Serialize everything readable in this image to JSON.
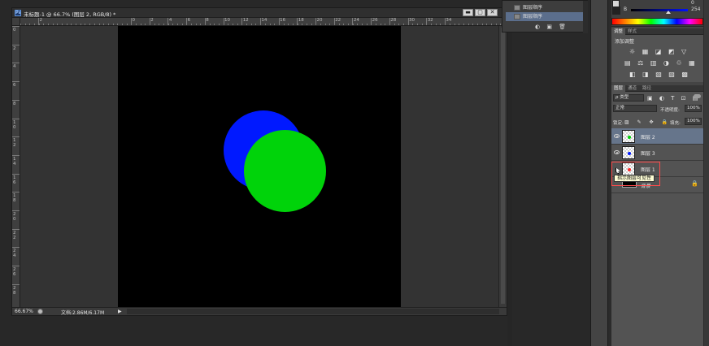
{
  "document": {
    "app_icon": "Ps",
    "title": "未标题-1 @ 66.7% (图层 2, RGB/8) *",
    "win_min": "▬",
    "win_max": "▢",
    "win_close": "✕",
    "ruler_h_labels": [
      "2",
      "0",
      "2",
      "4",
      "6",
      "8",
      "10",
      "12",
      "14",
      "16",
      "18",
      "20",
      "22",
      "24",
      "26",
      "28",
      "30",
      "32",
      "34"
    ],
    "ruler_v_labels": [
      "0",
      "2",
      "4",
      "6",
      "8",
      "1 0",
      "1 2",
      "1 4",
      "1 6",
      "1 8",
      "2 0",
      "2 2",
      "2 4",
      "2 6",
      "2 8"
    ],
    "zoom": "66.67%",
    "doc_size": "文档:2.86M/6.17M",
    "status_arrow": "▶",
    "canvas_color": "#000000",
    "shapes": [
      {
        "name": "blue-circle",
        "color": "#0019ff"
      },
      {
        "name": "green-circle",
        "color": "#00d30a"
      }
    ]
  },
  "history": {
    "items": [
      {
        "label": "图层顺序",
        "active": false
      },
      {
        "label": "图层顺序",
        "active": true
      }
    ],
    "toolbar_icons": "◐ ▣ 🗑"
  },
  "color": {
    "top_value": "0",
    "b_label": "B",
    "b_value": "254"
  },
  "adjustments": {
    "tabs": [
      "调整",
      "样式"
    ],
    "title": "添加调整",
    "row1": "☼ ▦ ◪ ◩ ▽",
    "row2": "▤ ⚖ ▥ ◑ ♲ ▦",
    "row3": "◧ ◨ ▧ ▨ ▩"
  },
  "layers": {
    "tabs": [
      "图层",
      "通道",
      "路径"
    ],
    "filter_kind": "ρ 类型",
    "filter_icons": "▣ ◐ T ⊡ ▤",
    "blend_mode": "正常",
    "opacity_label": "不透明度:",
    "opacity_value": "100%",
    "lock_label": "锁定:",
    "lock_icons": "▨ ✎ ✥ 🔒",
    "fill_label": "填充:",
    "fill_value": "100%",
    "rows": [
      {
        "name": "图层 2",
        "dot_color": "#00d30a",
        "selected": true
      },
      {
        "name": "图层 3",
        "dot_color": "#0019ff",
        "selected": false
      },
      {
        "name": "图层 1",
        "dot_color": "#ff2a2a",
        "selected": false
      }
    ],
    "background_name": "背景",
    "lock_badge": "🔒",
    "tooltip": "指示图层可见性"
  }
}
